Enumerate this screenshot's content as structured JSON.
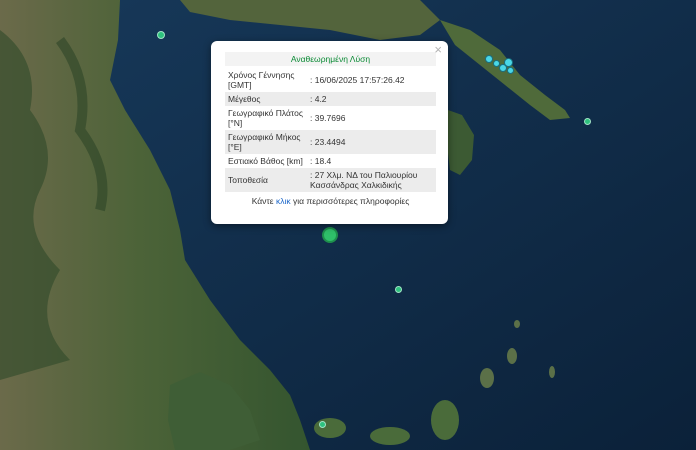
{
  "popup": {
    "title": "Αναθεωρημένη Λύση",
    "close_symbol": "×",
    "rows": [
      {
        "label": "Χρόνος Γέννησης [GMT]",
        "value": ": 16/06/2025 17:57:26.42"
      },
      {
        "label": "Μέγεθος",
        "value": ": 4.2"
      },
      {
        "label": "Γεωγραφικό Πλάτος [°N]",
        "value": ": 39.7696"
      },
      {
        "label": "Γεωγραφικό Μήκος [°E]",
        "value": ": 23.4494"
      },
      {
        "label": "Εστιακό Βάθος [km]",
        "value": ": 18.4"
      },
      {
        "label": "Τοποθεσία",
        "value": ": 27 Χλμ. ΝΔ του Παλιουρίου Κασσάνδρας Χαλκιδικής"
      }
    ],
    "more_prefix": "Κάντε ",
    "more_link": "κλικ",
    "more_suffix": " για περισσότερες πληροφορίες"
  },
  "colors": {
    "sea": "#0f2a44",
    "land": "#3f5b34",
    "marker_green": "#2ec27e",
    "marker_cyan": "#4ad7e6",
    "title_green": "#0a8a34",
    "link_blue": "#1b66c9"
  }
}
